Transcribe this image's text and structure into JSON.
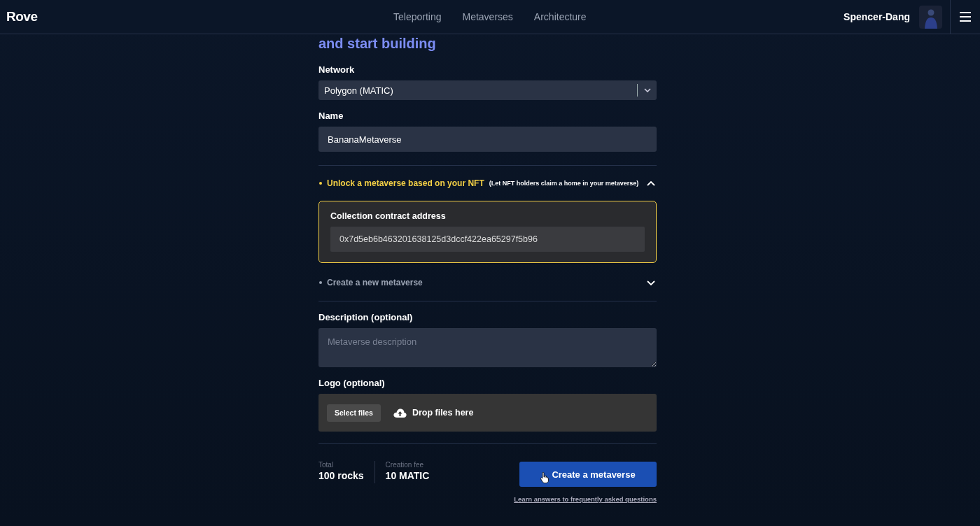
{
  "header": {
    "logo": "Rove",
    "nav": [
      {
        "label": "Teleporting"
      },
      {
        "label": "Metaverses"
      },
      {
        "label": "Architecture"
      }
    ],
    "user": "Spencer-Dang"
  },
  "heading": "and start building",
  "form": {
    "network": {
      "label": "Network",
      "value": "Polygon (MATIC)"
    },
    "name": {
      "label": "Name",
      "value": "BananaMetaverse"
    },
    "options": [
      {
        "title": "Unlock a metaverse based on your NFT",
        "note": "(Let NFT holders claim a home in your metaverse)",
        "expanded": true,
        "field": {
          "label": "Collection contract address",
          "value": "0x7d5eb6b463201638125d3dccf422ea65297f5b96"
        }
      },
      {
        "title": "Create a new metaverse",
        "expanded": false
      }
    ],
    "description": {
      "label": "Description (optional)",
      "placeholder": "Metaverse description"
    },
    "logo": {
      "label": "Logo (optional)",
      "button": "Select files",
      "drop_hint": "Drop files here"
    }
  },
  "summary": [
    {
      "label": "Total",
      "value": "100 rocks"
    },
    {
      "label": "Creation fee",
      "value": "10 MATIC"
    }
  ],
  "submit": "Create a metaverse",
  "faq_link": "Learn answers to frequently asked questions"
}
